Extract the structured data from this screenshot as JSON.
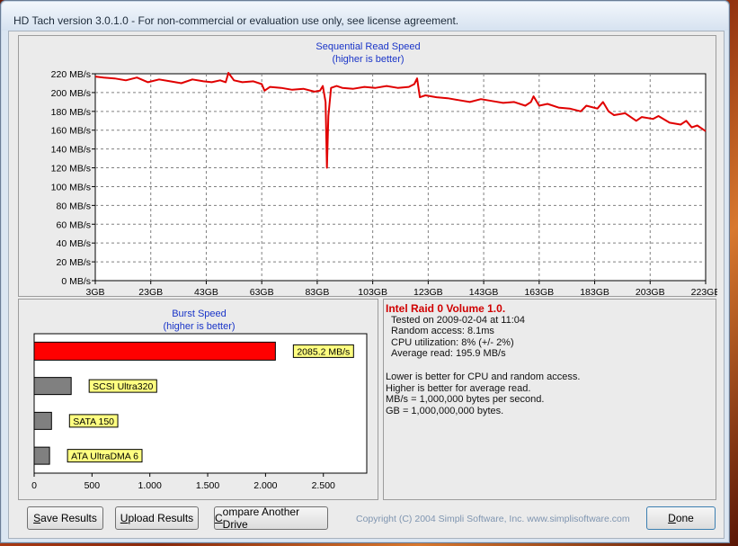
{
  "window": {
    "title": "HD Tach version 3.0.1.0  - For non-commercial or evaluation use only, see license agreement."
  },
  "sequential_chart": {
    "title": "Sequential Read Speed",
    "subtitle": "(higher is better)",
    "line_color": "#e00000"
  },
  "burst_chart": {
    "title": "Burst Speed",
    "subtitle": "(higher is better)",
    "bar_colors": {
      "primary": "#ff0000",
      "reference": "#808080"
    },
    "label_bg": "#ffff80"
  },
  "chart_data": [
    {
      "type": "line",
      "title": "Sequential Read Speed",
      "subtitle": "(higher is better)",
      "xlabel": "",
      "ylabel": "",
      "x_ticks": [
        "3GB",
        "23GB",
        "43GB",
        "63GB",
        "83GB",
        "103GB",
        "123GB",
        "143GB",
        "163GB",
        "183GB",
        "203GB",
        "223GB"
      ],
      "y_ticks": [
        "0 MB/s",
        "20 MB/s",
        "40 MB/s",
        "60 MB/s",
        "80 MB/s",
        "100 MB/s",
        "120 MB/s",
        "140 MB/s",
        "160 MB/s",
        "180 MB/s",
        "200 MB/s",
        "220 MB/s"
      ],
      "xlim": [
        3,
        223
      ],
      "ylim": [
        0,
        220
      ],
      "grid": true,
      "series": [
        {
          "x": [
            3,
            6,
            10,
            14,
            18,
            22,
            26,
            30,
            34,
            38,
            42,
            45,
            48,
            50,
            51,
            53,
            56,
            60,
            63,
            64,
            66,
            70,
            74,
            78,
            82,
            84,
            85,
            86,
            86.5,
            87,
            88,
            90,
            92,
            96,
            100,
            104,
            108,
            112,
            116,
            118,
            119,
            120,
            122,
            126,
            130,
            134,
            138,
            142,
            146,
            150,
            154,
            158,
            160,
            161,
            163,
            166,
            170,
            174,
            178,
            180,
            184,
            186,
            188,
            190,
            194,
            198,
            200,
            204,
            206,
            210,
            214,
            216,
            218,
            220,
            223
          ],
          "y": [
            217,
            216,
            215,
            213,
            216,
            211,
            214,
            212,
            210,
            214,
            212,
            211,
            213,
            211,
            221,
            213,
            211,
            212,
            209,
            202,
            206,
            205,
            203,
            204,
            201,
            202,
            207,
            190,
            120,
            175,
            205,
            207,
            205,
            204,
            206,
            205,
            207,
            205,
            206,
            209,
            215,
            195,
            197,
            195,
            194,
            192,
            190,
            193,
            191,
            189,
            190,
            186,
            190,
            196,
            186,
            188,
            184,
            183,
            180,
            186,
            183,
            190,
            180,
            176,
            178,
            170,
            174,
            172,
            175,
            168,
            166,
            170,
            163,
            165,
            159
          ]
        }
      ]
    },
    {
      "type": "bar",
      "title": "Burst Speed",
      "subtitle": "(higher is better)",
      "orientation": "horizontal",
      "categories": [
        "2085.2 MB/s",
        "SCSI Ultra320",
        "SATA 150",
        "ATA UltraDMA 6"
      ],
      "values": [
        2085.2,
        320,
        150,
        133
      ],
      "x_ticks": [
        "0",
        "500",
        "1.000",
        "1.500",
        "2.000",
        "2.500"
      ],
      "xlim": [
        0,
        2875
      ]
    }
  ],
  "info": {
    "drive_name": "Intel Raid 0 Volume 1.0.",
    "tested_on": "Tested on 2009-02-04 at 11:04",
    "random_access": "Random access: 8.1ms",
    "cpu_utilization": "CPU utilization: 8% (+/- 2%)",
    "average_read": "Average read: 195.9 MB/s",
    "note1": "Lower is better for CPU and random access.",
    "note2": "Higher is better for average read.",
    "note3": "MB/s = 1,000,000 bytes per second.",
    "note4": "GB = 1,000,000,000 bytes."
  },
  "footer": {
    "save_first": "S",
    "save_rest": "ave Results",
    "upload_first": "U",
    "upload_rest": "pload Results",
    "compare_first": "C",
    "compare_rest": "ompare Another Drive",
    "copyright": "Copyright (C) 2004 Simpli Software, Inc. www.simplisoftware.com",
    "done_first": "D",
    "done_rest": "one"
  }
}
